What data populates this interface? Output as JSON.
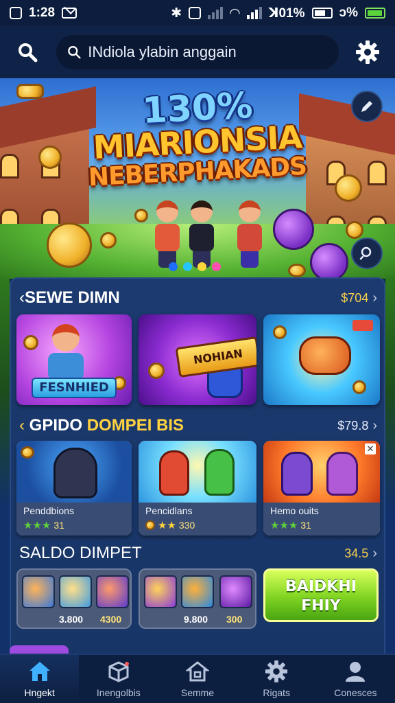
{
  "status_bar": {
    "time": "1:28",
    "battery_text": "ꓘ01%",
    "battery_text2": "ↄ%"
  },
  "header": {
    "search_placeholder": "INdiola ylabin anggain"
  },
  "hero": {
    "line1": "130%",
    "line2": "MIARIONSIA",
    "line3": "NEBERPHAKADS",
    "dots": [
      "#1f6fff",
      "#27c5ff",
      "#ffd73a",
      "#ff4fb0"
    ]
  },
  "sections": [
    {
      "title": "SEWE DIMN",
      "more": "$704",
      "cards": [
        {
          "label": "FESNHIED"
        },
        {
          "label": "NOHIAN"
        },
        {
          "label": ""
        }
      ]
    },
    {
      "title_a": "GPIDO ",
      "title_b": "DOMPEI BIS",
      "more": "$79.8",
      "cards": [
        {
          "name": "Penddbions",
          "rating": "31"
        },
        {
          "name": "Pencidlans",
          "rating": "330"
        },
        {
          "name": "Hemo ouits",
          "rating": "31"
        }
      ]
    },
    {
      "title": "SALDO DIMPET",
      "more": "34.5",
      "cards": [
        {
          "prices": [
            "3.800",
            "4300"
          ]
        },
        {
          "prices": [
            "9.800",
            "300"
          ]
        }
      ],
      "cta": {
        "line1": "BAIDKHI",
        "line2": "FHIY"
      }
    }
  ],
  "bottom_nav": [
    {
      "label": "Hngekt",
      "icon": "home-icon",
      "active": true
    },
    {
      "label": "Inengolbis",
      "icon": "cube-box-icon",
      "active": false
    },
    {
      "label": "Semme",
      "icon": "house-outline-icon",
      "active": false
    },
    {
      "label": "Rigats",
      "icon": "gear-icon",
      "active": false
    },
    {
      "label": "Conesces",
      "icon": "profile-icon",
      "active": false
    }
  ],
  "colors": {
    "accent": "#ffd23f",
    "background": "#10264f",
    "panel": "#1c3a6f",
    "cta_green": "#7ed321"
  }
}
